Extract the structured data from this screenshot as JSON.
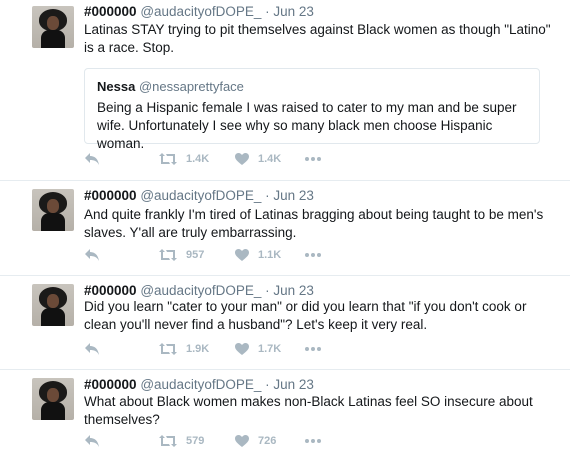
{
  "colors": {
    "text": "#14171a",
    "secondary": "#657786",
    "action": "#aab8c2",
    "divider": "#e6ecf0"
  },
  "tweets": [
    {
      "name": "#000000",
      "handle": "@audacityofDOPE_",
      "separator": "·",
      "date": "Jun 23",
      "text": "Latinas STAY trying to pit themselves against Black women as though \"Latino\" is a race. Stop.",
      "quote": {
        "name": "Nessa",
        "handle": "@nessaprettyface",
        "text": "Being a Hispanic female I was raised to cater to my man and be super wife. Unfortunately I see why so many black men choose Hispanic woman."
      },
      "retweets": "1.4K",
      "likes": "1.4K"
    },
    {
      "name": "#000000",
      "handle": "@audacityofDOPE_",
      "separator": "·",
      "date": "Jun 23",
      "text": "And quite frankly I'm tired of Latinas bragging about being taught to be men's slaves. Y'all are truly embarrassing.",
      "retweets": "957",
      "likes": "1.1K"
    },
    {
      "name": "#000000",
      "handle": "@audacityofDOPE_",
      "separator": "·",
      "date": "Jun 23",
      "text": "Did you learn \"cater to your man\" or did you learn that \"if you don't cook or clean you'll never find a husband\"? Let's keep it very real.",
      "retweets": "1.9K",
      "likes": "1.7K"
    },
    {
      "name": "#000000",
      "handle": "@audacityofDOPE_",
      "separator": "·",
      "date": "Jun 23",
      "text": "What about Black women makes non-Black Latinas feel SO insecure about themselves?",
      "retweets": "579",
      "likes": "726"
    }
  ],
  "icons": [
    "reply-icon",
    "retweet-icon",
    "like-icon",
    "more-icon"
  ]
}
